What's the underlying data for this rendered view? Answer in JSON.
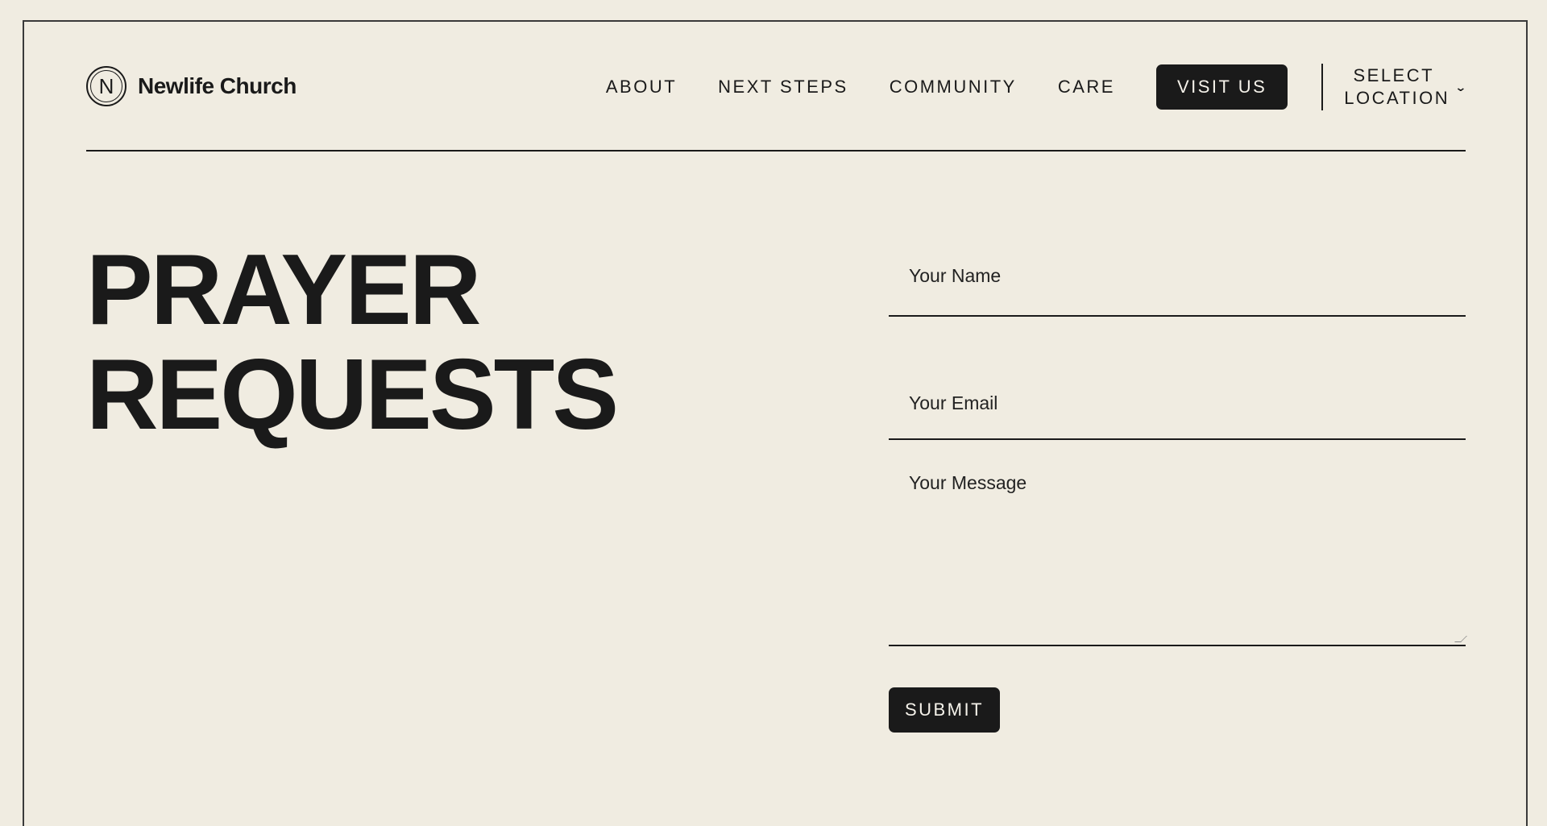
{
  "brand": {
    "logo_letter": "N",
    "name": "Newlife Church"
  },
  "nav": {
    "items": [
      {
        "label": "ABOUT"
      },
      {
        "label": "NEXT STEPS"
      },
      {
        "label": "COMMUNITY"
      },
      {
        "label": "CARE"
      }
    ],
    "visit_label": "VISIT US",
    "location_label": "SELECT LOCATION"
  },
  "page": {
    "title_line1": "PRAYER",
    "title_line2": "REQUESTS"
  },
  "form": {
    "name_placeholder": "Your Name",
    "email_placeholder": "Your Email",
    "message_placeholder": "Your Message",
    "submit_label": "SUBMIT"
  },
  "colors": {
    "background": "#f0ece1",
    "ink": "#1a1a1a",
    "button_text": "#f5f2ea"
  }
}
